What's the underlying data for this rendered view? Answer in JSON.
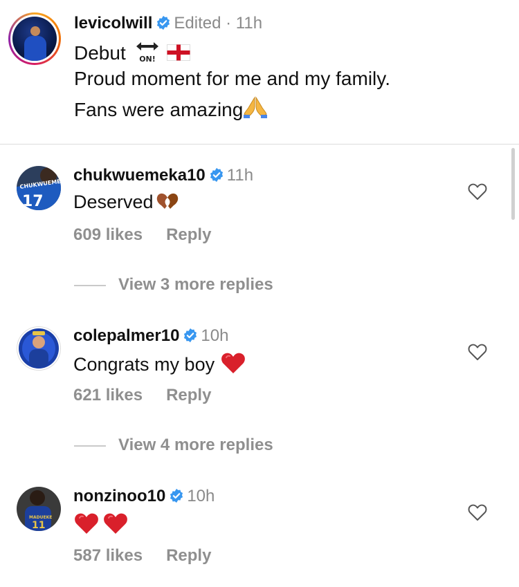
{
  "caption": {
    "username": "levicolwill",
    "edited": "Edited",
    "time": "11h",
    "line1": "Debut",
    "line2": "Proud moment for me and my family.",
    "line3": "Fans were amazing",
    "on_icon_text": "ON!",
    "line1_icons": [
      "on-arrow-icon",
      "england-flag-icon"
    ],
    "line3_icon": "praying-hands-icon"
  },
  "comments": [
    {
      "username": "chukwuemeka10",
      "time": "11h",
      "text": "Deserved",
      "text_icons": [
        "heart-hands-icon"
      ],
      "likes": "609 likes",
      "reply": "Reply",
      "view_more": "View 3 more replies",
      "avatar_number": "17",
      "avatar_text": "CHUKWUEMEKA"
    },
    {
      "username": "colepalmer10",
      "time": "10h",
      "text": "Congrats my boy",
      "text_icons": [
        "red-heart-icon"
      ],
      "likes": "621 likes",
      "reply": "Reply",
      "view_more": "View 4 more replies"
    },
    {
      "username": "nonzinoo10",
      "time": "10h",
      "text": "",
      "text_icons": [
        "red-heart-icon",
        "red-heart-icon"
      ],
      "likes": "587 likes",
      "reply": "Reply",
      "avatar_number": "11",
      "avatar_text": "MADUEKE"
    }
  ],
  "colors": {
    "verified": "#3897f0",
    "muted": "#8e8e8e",
    "heart": "#e0242e"
  }
}
